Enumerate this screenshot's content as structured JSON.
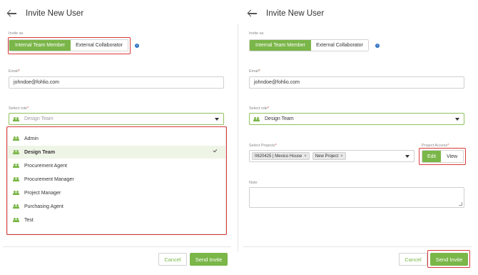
{
  "left": {
    "title": "Invite New User",
    "invite_as_label": "Invite as",
    "invite_options": [
      "Internal Team Member",
      "External Collaborator"
    ],
    "email_label": "Email",
    "email_value": "johndoe@fohlio.com",
    "role_label": "Select role",
    "role_placeholder": "Design Team",
    "roles": [
      "Admin",
      "Design Team",
      "Procurement Agent",
      "Procurement Manager",
      "Project Manager",
      "Purchasing Agent",
      "Test"
    ],
    "selected_role": "Design Team",
    "cancel_label": "Cancel",
    "send_label": "Send Invite"
  },
  "right": {
    "title": "Invite New User",
    "invite_as_label": "Invite as",
    "invite_options": [
      "Internal Team Member",
      "External Collaborator"
    ],
    "email_label": "Email",
    "email_value": "johndoe@fohlio.com",
    "role_label": "Select role",
    "role_value": "Design Team",
    "projects_label": "Select Projects",
    "projects": [
      "0620425 | Mexico House",
      "New Project"
    ],
    "access_label": "Project Access",
    "access_options": [
      "Edit",
      "View"
    ],
    "note_label": "Note",
    "cancel_label": "Cancel",
    "send_label": "Send Invite"
  },
  "colors": {
    "accent": "#7ab648",
    "highlight": "#d83a3a",
    "required": "#e0453a",
    "info": "#2f73c4"
  }
}
